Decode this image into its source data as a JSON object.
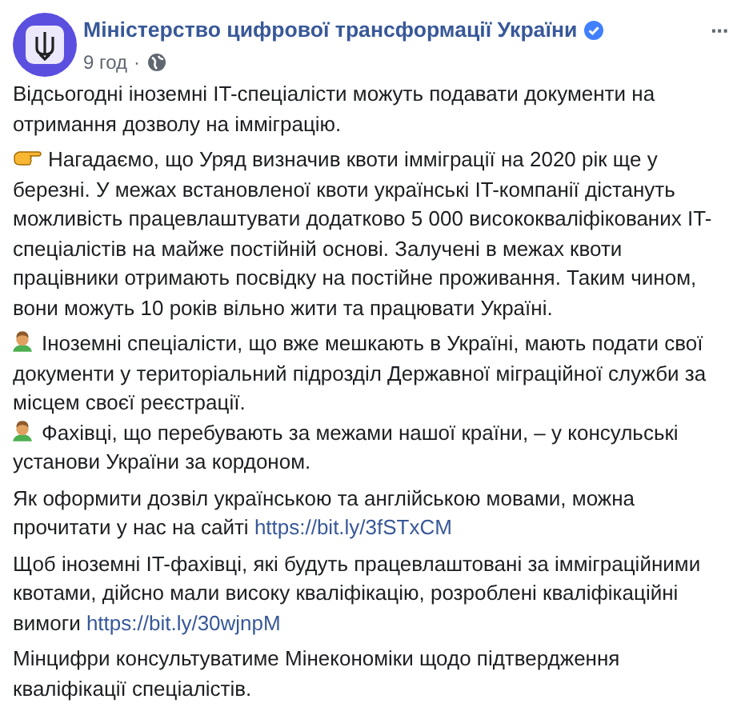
{
  "post": {
    "author": "Міністерство цифрової трансформації України",
    "verified": true,
    "time": "9 год",
    "separator": "·",
    "more": "···",
    "paragraphs": [
      {
        "entries": [
          {
            "kind": "plain",
            "text": "Відсьогодні іноземні IT-спеціалісти можуть подавати документи на отримання дозволу на імміграцію."
          }
        ]
      },
      {
        "entries": [
          {
            "kind": "hand",
            "text": "Нагадаємо, що Уряд визначив квоти імміграції на 2020 рік ще у березні. У межах встановленої квоти українські IT-компанії дістануть можливість працевлаштувати додатково 5 000 висококваліфікованих IT-спеціалістів на майже постійній основі. Залучені в межах квоти працівники отримають посвідку на постійне проживання. Таким чином, вони можуть 10 років вільно жити та працювати Україні."
          }
        ]
      },
      {
        "entries": [
          {
            "kind": "person",
            "text": "Іноземні спеціалісти, що вже мешкають в Україні, мають подати свої документи у територіальний підрозділ Державної міграційної служби за місцем своєї реєстрації."
          },
          {
            "kind": "person",
            "text": "Фахівці, що перебувають за межами нашої країни, – у консульські установи України за кордоном."
          }
        ]
      },
      {
        "entries": [
          {
            "kind": "plain",
            "text": "Як оформити дозвіл українською та англійською мовами, можна прочитати у нас на сайті",
            "link": "https://bit.ly/3fSTxCM"
          }
        ]
      },
      {
        "entries": [
          {
            "kind": "plain",
            "text": "Щоб іноземні IT-фахівці, які будуть працевлаштовані за імміграційними квотами, дійсно мали високу кваліфікацію, розроблені кваліфікаційні вимоги",
            "link": "https://bit.ly/30wjnpM"
          }
        ]
      },
      {
        "entries": [
          {
            "kind": "plain",
            "text": "Мінцифри консультуватиме Мінекономіки щодо підтвердження кваліфікації спеціалістів."
          }
        ]
      }
    ]
  }
}
